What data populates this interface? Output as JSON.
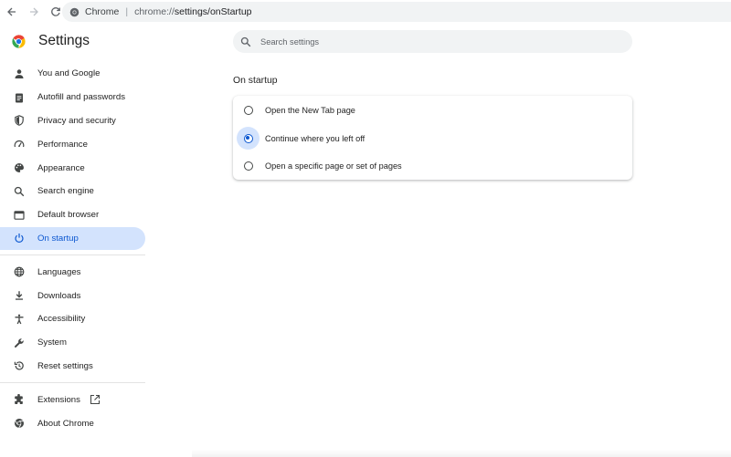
{
  "browser": {
    "site_name": "Chrome",
    "separator": "|",
    "url_prefix": "chrome://",
    "url_path": "settings/onStartup"
  },
  "sidebar": {
    "title": "Settings",
    "items": [
      {
        "label": "You and Google",
        "icon": "person-icon"
      },
      {
        "label": "Autofill and passwords",
        "icon": "clipboard-icon"
      },
      {
        "label": "Privacy and security",
        "icon": "shield-icon"
      },
      {
        "label": "Performance",
        "icon": "speedometer-icon"
      },
      {
        "label": "Appearance",
        "icon": "palette-icon"
      },
      {
        "label": "Search engine",
        "icon": "search-icon"
      },
      {
        "label": "Default browser",
        "icon": "browser-window-icon"
      },
      {
        "label": "On startup",
        "icon": "power-icon",
        "active": true
      },
      {
        "label": "Languages",
        "icon": "globe-icon"
      },
      {
        "label": "Downloads",
        "icon": "download-icon"
      },
      {
        "label": "Accessibility",
        "icon": "accessibility-icon"
      },
      {
        "label": "System",
        "icon": "wrench-icon"
      },
      {
        "label": "Reset settings",
        "icon": "history-icon"
      },
      {
        "label": "Extensions",
        "icon": "puzzle-icon"
      },
      {
        "label": "About Chrome",
        "icon": "chrome-icon"
      }
    ]
  },
  "search": {
    "placeholder": "Search settings",
    "value": ""
  },
  "section": {
    "title": "On startup"
  },
  "startup_options": [
    {
      "label": "Open the New Tab page",
      "selected": false
    },
    {
      "label": "Continue where you left off",
      "selected": true
    },
    {
      "label": "Open a specific page or set of pages",
      "selected": false
    }
  ],
  "colors": {
    "accent": "#0b57d0",
    "active_bg": "#d3e3fd",
    "search_bg": "#f1f3f4"
  }
}
